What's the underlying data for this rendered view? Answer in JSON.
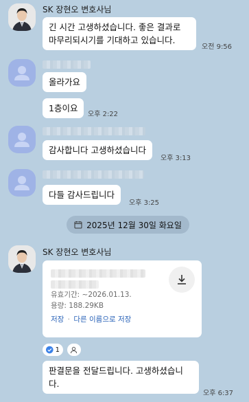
{
  "messages": [
    {
      "sender": "SK 장현오 변호사님",
      "text": "긴 시간 고생하셨습니다. 좋은 결과로 마무리되시기를 기대하고 있습니다.",
      "time": "오전 9:56"
    },
    {
      "text": "올라가요"
    },
    {
      "text": "1층이요",
      "time": "오후 2:22"
    },
    {
      "text": "감사합니다 고생하셨습니다",
      "time": "오후 3:13"
    },
    {
      "text": "다들 감사드립니다",
      "time": "오후 3:25"
    }
  ],
  "date_divider": "2025년 12월 30일 화요일",
  "file_message": {
    "sender": "SK 장현오 변호사님",
    "expiry": "유효기간: ~2026.01.13.",
    "size": "용량: 188.29KB",
    "save": "저장",
    "save_as": "다른 이름으로 저장",
    "separator": "·",
    "reaction_count": "1"
  },
  "last_message": {
    "text": "판결문을 전달드립니다. 고생하셨습니다.",
    "time": "오후 6:37"
  },
  "colors": {
    "background": "#b9cfe0",
    "link": "#2a63b8",
    "avatar_blank": "#9fb3e6"
  }
}
